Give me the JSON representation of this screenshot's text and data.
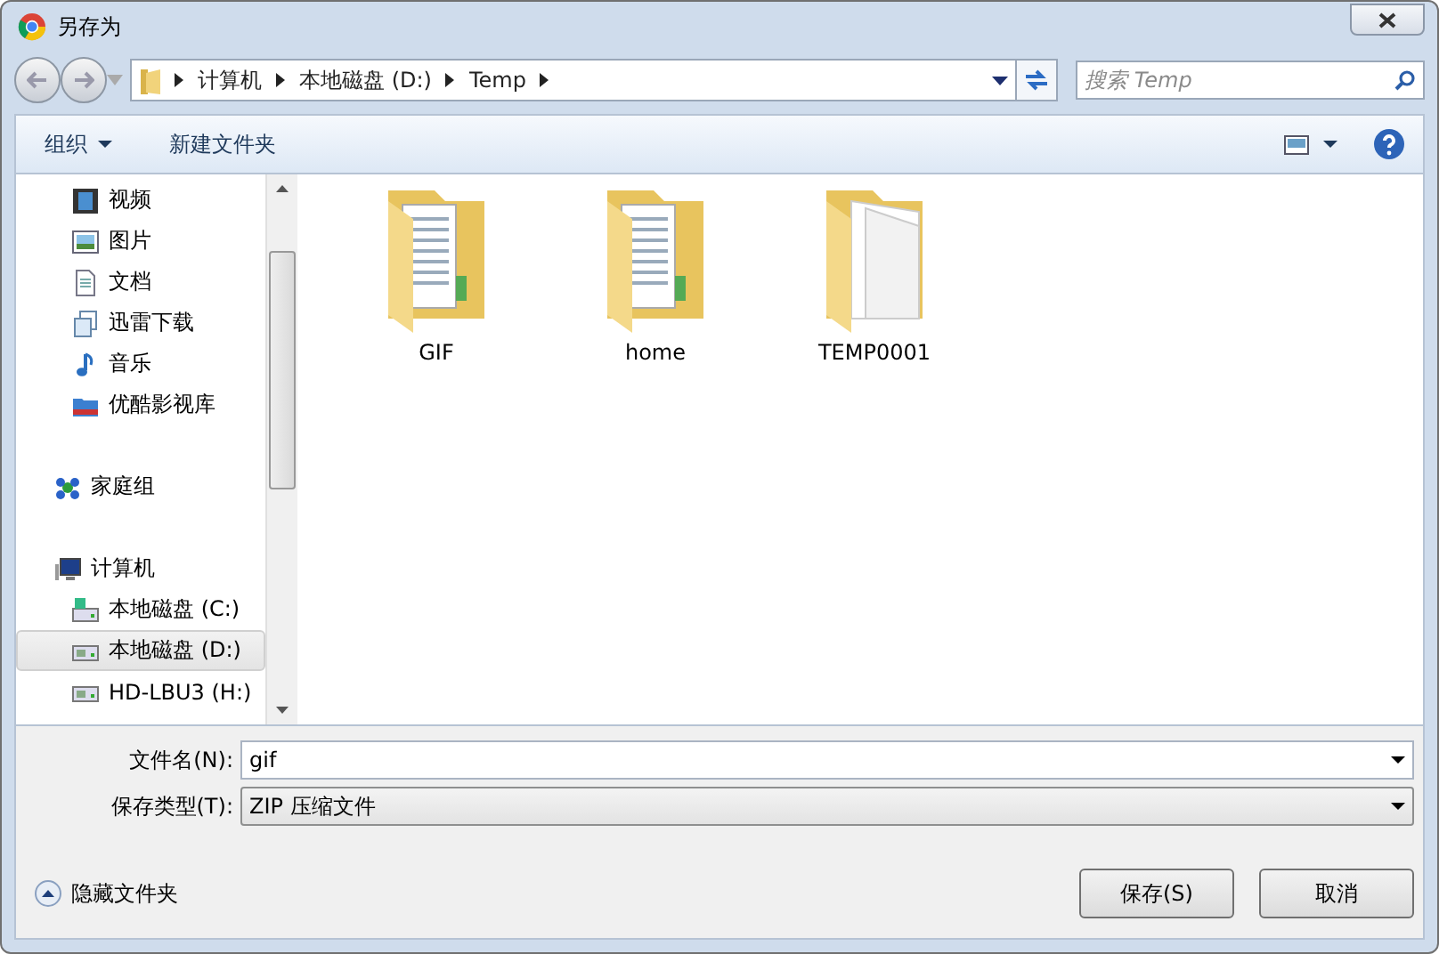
{
  "window": {
    "title": "另存为"
  },
  "address": {
    "crumbs": [
      "计算机",
      "本地磁盘 (D:)",
      "Temp"
    ]
  },
  "search": {
    "placeholder": "搜索 Temp"
  },
  "toolbar": {
    "organize": "组织",
    "new_folder": "新建文件夹"
  },
  "sidebar": {
    "sections": [
      {
        "children": [
          {
            "label": "视频",
            "kind": "video",
            "selected": false
          },
          {
            "label": "图片",
            "kind": "pictures",
            "selected": false
          },
          {
            "label": "文档",
            "kind": "documents",
            "selected": false
          },
          {
            "label": "迅雷下载",
            "kind": "download",
            "selected": false
          },
          {
            "label": "音乐",
            "kind": "music",
            "selected": false
          },
          {
            "label": "优酷影视库",
            "kind": "folder",
            "selected": false
          }
        ]
      },
      {
        "label": "家庭组",
        "kind": "homegroup"
      },
      {
        "label": "计算机",
        "kind": "computer",
        "children": [
          {
            "label": "本地磁盘 (C:)",
            "kind": "system_drive",
            "selected": false
          },
          {
            "label": "本地磁盘 (D:)",
            "kind": "drive",
            "selected": true
          },
          {
            "label": "HD-LBU3 (H:)",
            "kind": "drive",
            "selected": false
          }
        ]
      }
    ]
  },
  "files": [
    {
      "name": "GIF",
      "kind": "docs"
    },
    {
      "name": "home",
      "kind": "docs"
    },
    {
      "name": "TEMP0001",
      "kind": "blank"
    }
  ],
  "filename": {
    "label": "文件名(N):",
    "value": "gif"
  },
  "filetype": {
    "label": "保存类型(T):",
    "value": "ZIP 压缩文件"
  },
  "hide_folders": "隐藏文件夹",
  "buttons": [
    "保存(S)",
    "取消"
  ]
}
